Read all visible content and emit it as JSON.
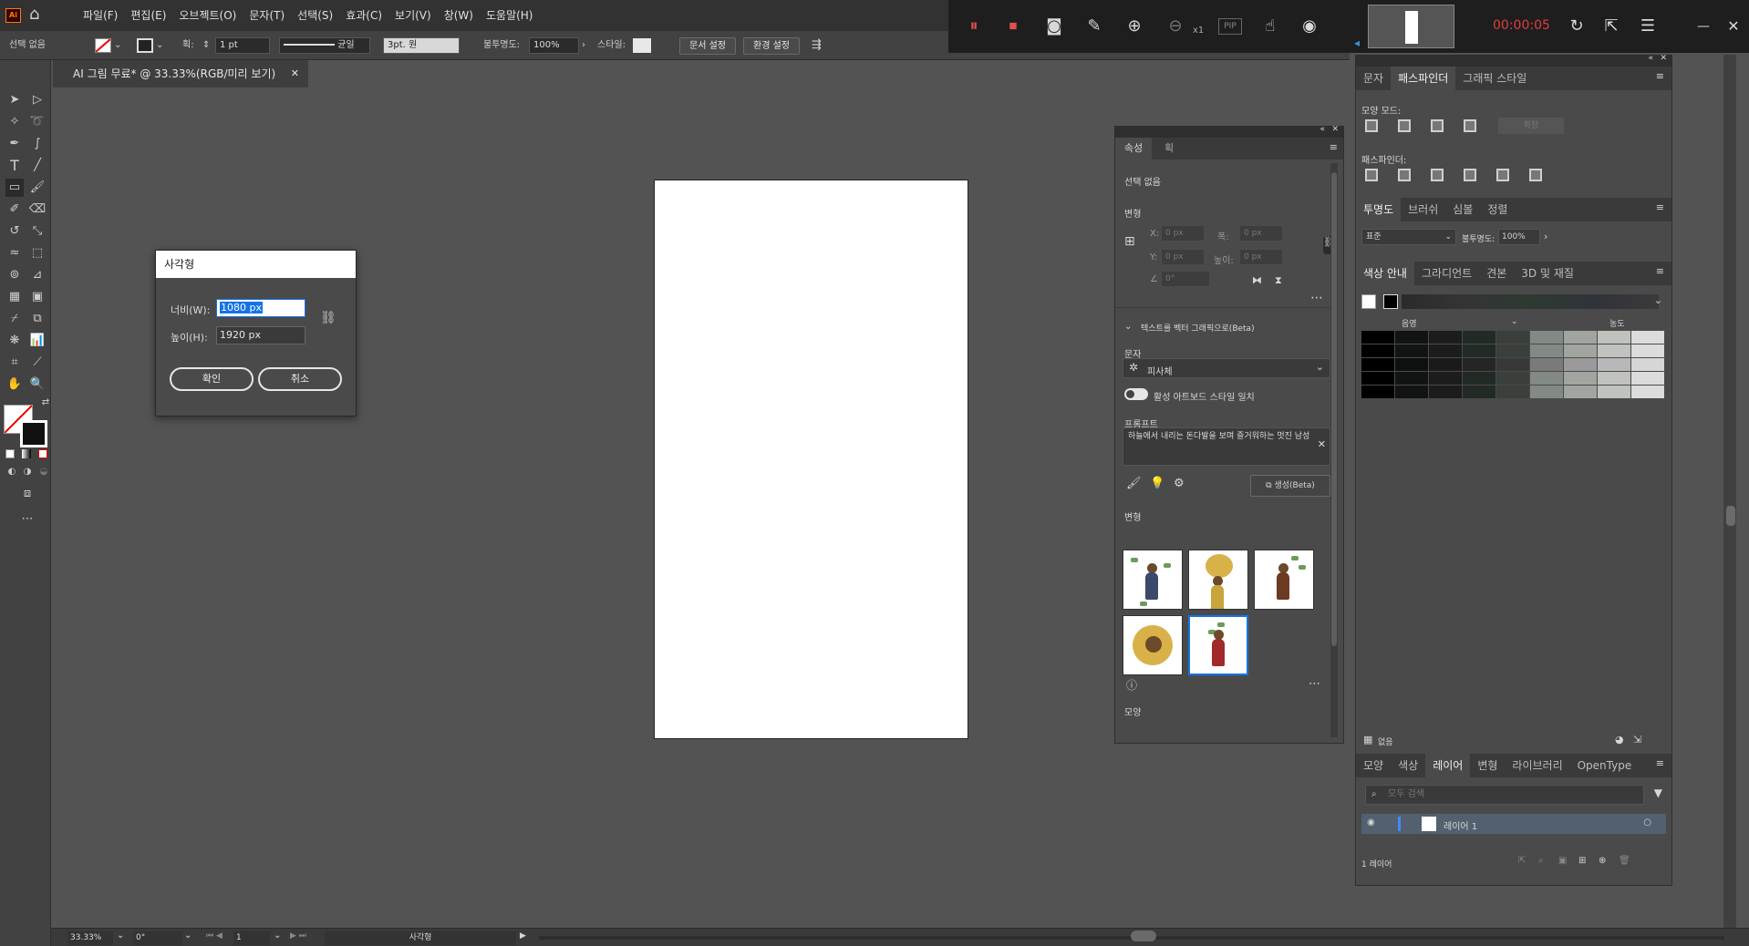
{
  "app": {
    "logo_text": "Ai"
  },
  "menus": [
    "파일(F)",
    "편집(E)",
    "오브젝트(O)",
    "문자(T)",
    "선택(S)",
    "효과(C)",
    "보기(V)",
    "창(W)",
    "도움말(H)"
  ],
  "control_bar": {
    "selection": "선택 없음",
    "stroke_label": "획:",
    "stroke_value": "1 pt",
    "line_style": "균일",
    "brush": "3pt. 원",
    "opacity_label": "불투명도:",
    "opacity_value": "100%",
    "style_label": "스타일:",
    "doc_setup": "문서 설정",
    "prefs": "환경 설정"
  },
  "recorder": {
    "timer": "00:00:05",
    "zoom_factor": "x1",
    "pip": "PIP"
  },
  "document_tab": {
    "title": "AI 그림 무료* @ 33.33%(RGB/미리 보기)"
  },
  "dialog": {
    "title": "사각형",
    "width_label": "너비(W):",
    "width_value": "1080 px",
    "height_label": "높이(H):",
    "height_value": "1920 px",
    "ok": "확인",
    "cancel": "취소"
  },
  "properties": {
    "tabs": [
      "속성",
      "획"
    ],
    "no_selection": "선택 없음",
    "transform": "변형",
    "x_label": "X:",
    "y_label": "Y:",
    "w_label": "폭:",
    "h_label": "높이:",
    "placeholder_px": "0 px",
    "angle": "0°",
    "text_to_vector": "텍스트를 벡터 그래픽으로(Beta)",
    "type_label": "문자",
    "type_value": "피사체",
    "match_style": "활성 아트보드 스타일 일치",
    "prompt_label": "프롬프트",
    "prompt_text": "하늘에서 내리는 돈다발을 보며 즐거워하는 멋진 남성",
    "generate": "생성(Beta)",
    "variations": "변형",
    "appearance": "모양"
  },
  "right_panel": {
    "top_tabs": [
      "문자",
      "패스파인더",
      "그래픽 스타일"
    ],
    "shape_modes": "모양 모드:",
    "expand": "확장",
    "pathfinders": "패스파인더:",
    "transparency_tabs": [
      "투명도",
      "브러쉬",
      "심볼",
      "정렬"
    ],
    "blend_mode": "표준",
    "opacity_label": "불투명도:",
    "opacity_value": "100%",
    "color_tabs": [
      "색상 안내",
      "그라디언트",
      "견본",
      "3D 및 재질"
    ],
    "shade_label": "음영",
    "tint_label": "농도",
    "none_label": "없음",
    "layer_tabs": [
      "모양",
      "색상",
      "레이어",
      "변형",
      "라이브러리",
      "OpenType"
    ],
    "search_placeholder": "모두 검색",
    "layer_name": "레이어 1",
    "layer_count": "1 레이어",
    "swatch_colors": [
      "#000000",
      "#0e1010",
      "#1a1a1a",
      "#252525",
      "#383838",
      "#545454",
      "#7a7a7a",
      "#9a9a9a",
      "#b8b8b8",
      "#d6d6d6"
    ],
    "swatch_tints": [
      "#000000",
      "#121414",
      "#1d1c1c",
      "#222a25",
      "#3a3f3c",
      "#5d6660",
      "#838a85",
      "#a1a59f",
      "#bfc2bd",
      "#dcdcdc"
    ]
  },
  "status_bar": {
    "zoom": "33.33%",
    "rotation": "0°",
    "artboard": "1",
    "tool": "사각형"
  }
}
